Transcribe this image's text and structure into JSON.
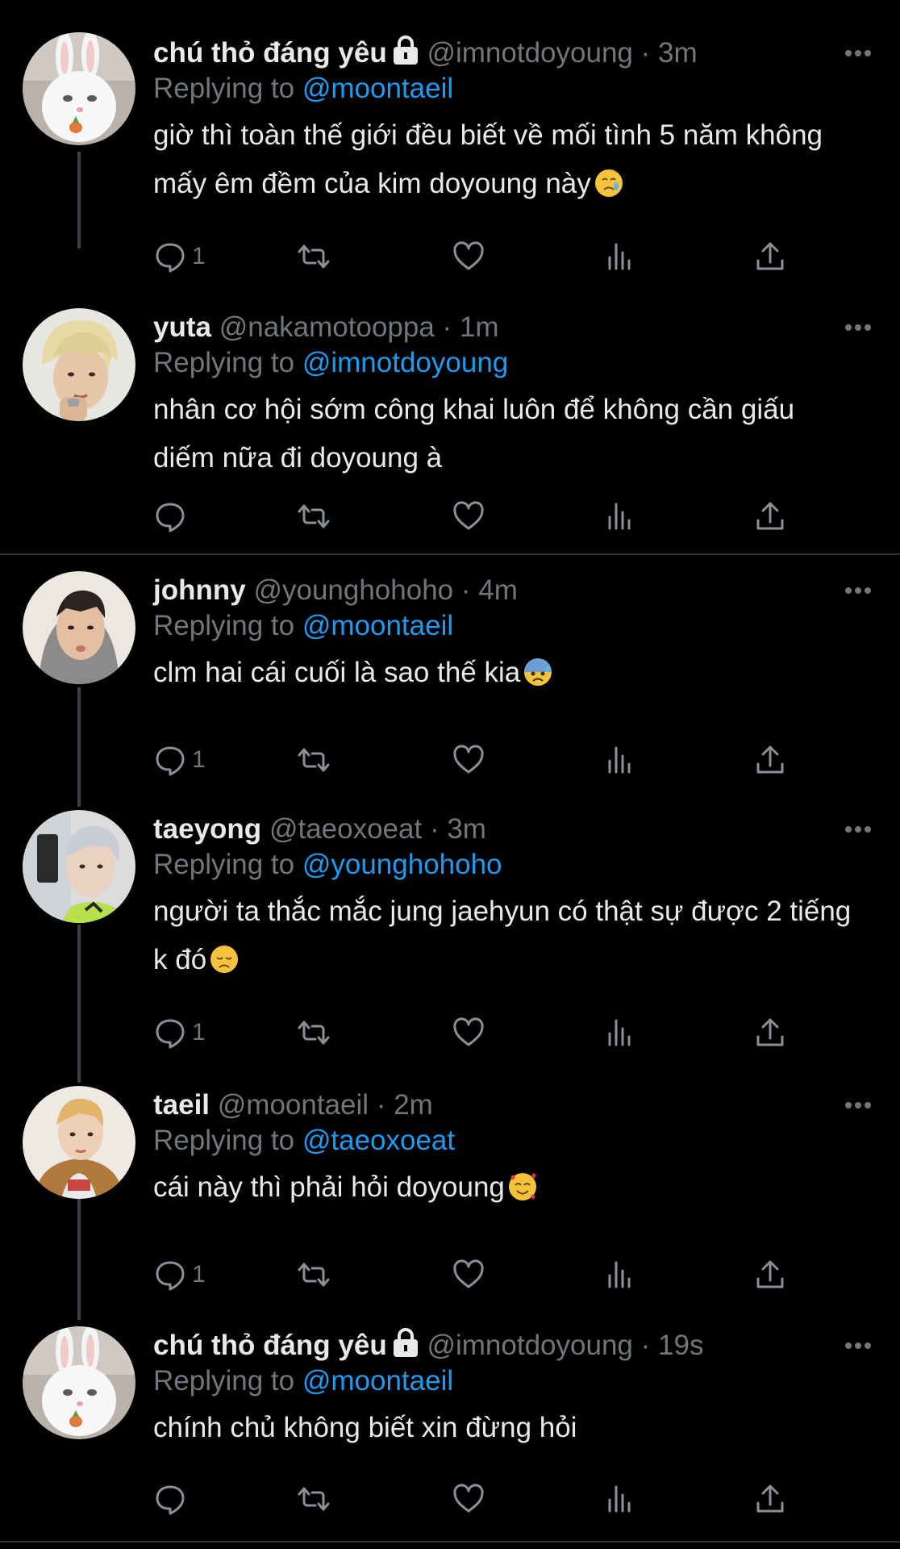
{
  "tweets": [
    {
      "name": "chú thỏ đáng yêu",
      "locked": true,
      "handle": "@imnotdoyoung",
      "dot": "·",
      "time": "3m",
      "replying_prefix": "Replying to",
      "replying_to": "@moontaeil",
      "text": "giờ thì toàn thế giới đều biết về mối tình 5 năm không mấy êm đềm của kim doyoung này",
      "emoji": "crying-face",
      "reply_count": "1"
    },
    {
      "name": "yuta",
      "locked": false,
      "handle": "@nakamotooppa",
      "dot": "·",
      "time": "1m",
      "replying_prefix": "Replying to",
      "replying_to": "@imnotdoyoung",
      "text": "nhân cơ hội sớm công khai luôn để không cần giấu diếm nữa đi doyoung à",
      "emoji": "",
      "reply_count": ""
    },
    {
      "name": "johnny",
      "locked": false,
      "handle": "@younghohoho",
      "dot": "·",
      "time": "4m",
      "replying_prefix": "Replying to",
      "replying_to": "@moontaeil",
      "text": "clm hai cái cuối là sao thế kia",
      "emoji": "anxious-face-with-sweat",
      "reply_count": "1"
    },
    {
      "name": "taeyong",
      "locked": false,
      "handle": "@taeoxoeat",
      "dot": "·",
      "time": "3m",
      "replying_prefix": "Replying to",
      "replying_to": "@younghohoho",
      "text": "người ta thắc mắc jung jaehyun có thật sự được 2 tiếng k đó",
      "emoji": "disappointed-face",
      "reply_count": "1"
    },
    {
      "name": "taeil",
      "locked": false,
      "handle": "@moontaeil",
      "dot": "·",
      "time": "2m",
      "replying_prefix": "Replying to",
      "replying_to": "@taeoxoeat",
      "text": "cái này thì phải hỏi doyoung",
      "emoji": "smiling-face-with-hearts",
      "reply_count": "1"
    },
    {
      "name": "chú thỏ đáng yêu",
      "locked": true,
      "handle": "@imnotdoyoung",
      "dot": "·",
      "time": "19s",
      "replying_prefix": "Replying to",
      "replying_to": "@moontaeil",
      "text": "chính chủ không biết xin đừng hỏi",
      "emoji": "",
      "reply_count": ""
    }
  ],
  "icons": {
    "reply": "reply-icon",
    "retweet": "retweet-icon",
    "like": "heart-icon",
    "views": "analytics-icon",
    "share": "share-icon",
    "more": "more-icon",
    "lock": "lock-icon"
  },
  "colors": {
    "background": "#000000",
    "text": "#e7e9ea",
    "secondary": "#71767b",
    "accent": "#1d9bf0",
    "thread_line": "#3d4147"
  }
}
